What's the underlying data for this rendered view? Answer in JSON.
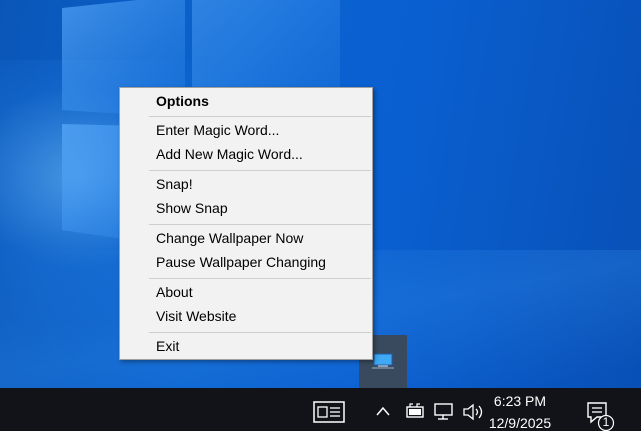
{
  "menu": {
    "title": "Options",
    "items": [
      {
        "label": "Enter Magic Word..."
      },
      {
        "label": "Add New Magic Word..."
      },
      {
        "label": "Snap!"
      },
      {
        "label": "Show Snap"
      },
      {
        "label": "Change Wallpaper Now"
      },
      {
        "label": "Pause Wallpaper Changing"
      },
      {
        "label": "About"
      },
      {
        "label": "Visit Website"
      },
      {
        "label": "Exit"
      }
    ]
  },
  "taskbar": {
    "time": "6:23 PM",
    "date": "12/9/2025",
    "notification_count": "1",
    "icons": [
      "news-widget-icon",
      "chevron-up-icon",
      "battery-icon",
      "network-icon",
      "volume-icon",
      "notification-icon"
    ]
  },
  "colors": {
    "desktop": "#0b63cf",
    "taskbar": "#111318",
    "menu_bg": "#f2f2f2"
  }
}
